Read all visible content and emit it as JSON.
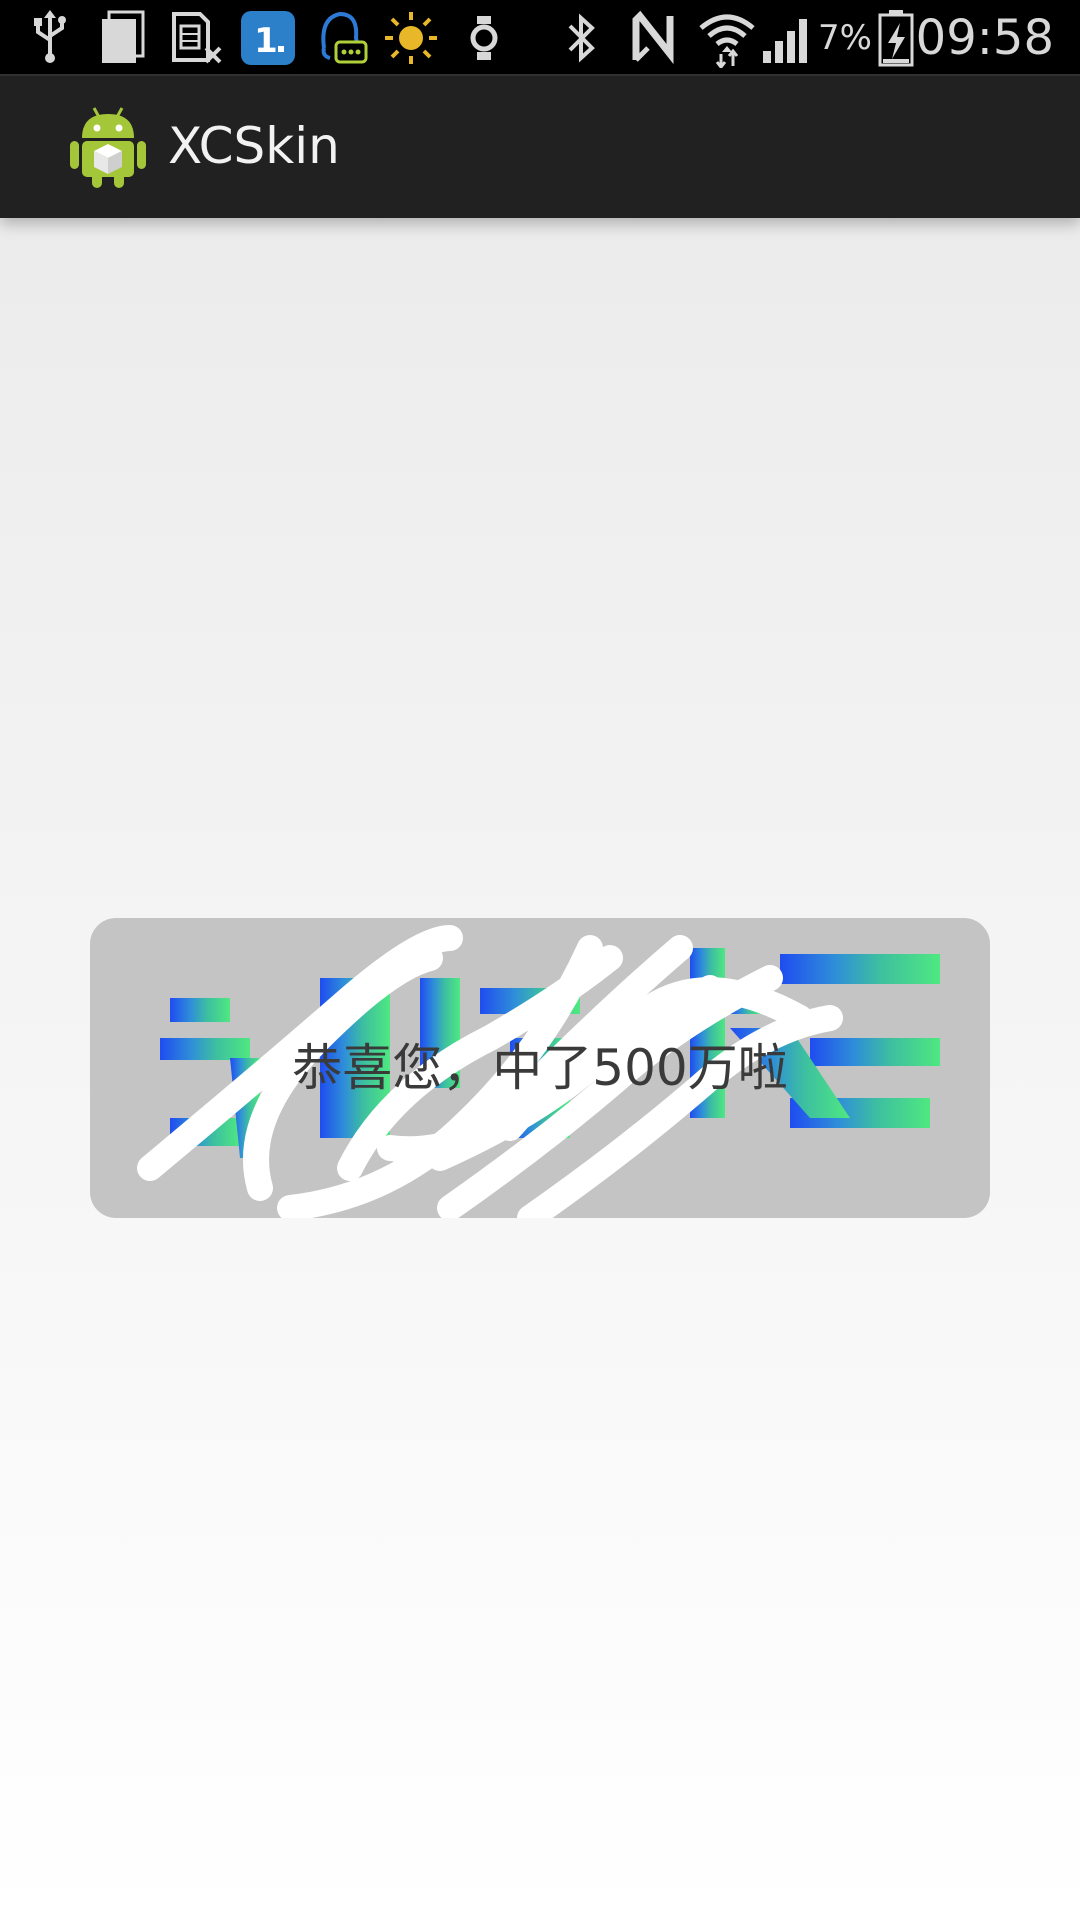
{
  "status_bar": {
    "battery_percent": "7%",
    "time": "09:58",
    "icons": [
      "usb-icon",
      "copy-icon",
      "sim-card-icon",
      "one-app-icon",
      "chat-notification-icon",
      "brightness-icon",
      "watch-icon",
      "bluetooth-icon",
      "nfc-icon",
      "wifi-icon",
      "signal-icon",
      "battery-icon"
    ]
  },
  "action_bar": {
    "title": "XCSkin",
    "icon": "android-icon"
  },
  "scratch_card": {
    "prize_text": "恭喜您，中了500万啦",
    "overlay_colors": [
      "#1f4cf0",
      "#2f8fd8",
      "#3dbfa0",
      "#4fe880"
    ],
    "background_color": "#c4c4c4"
  }
}
